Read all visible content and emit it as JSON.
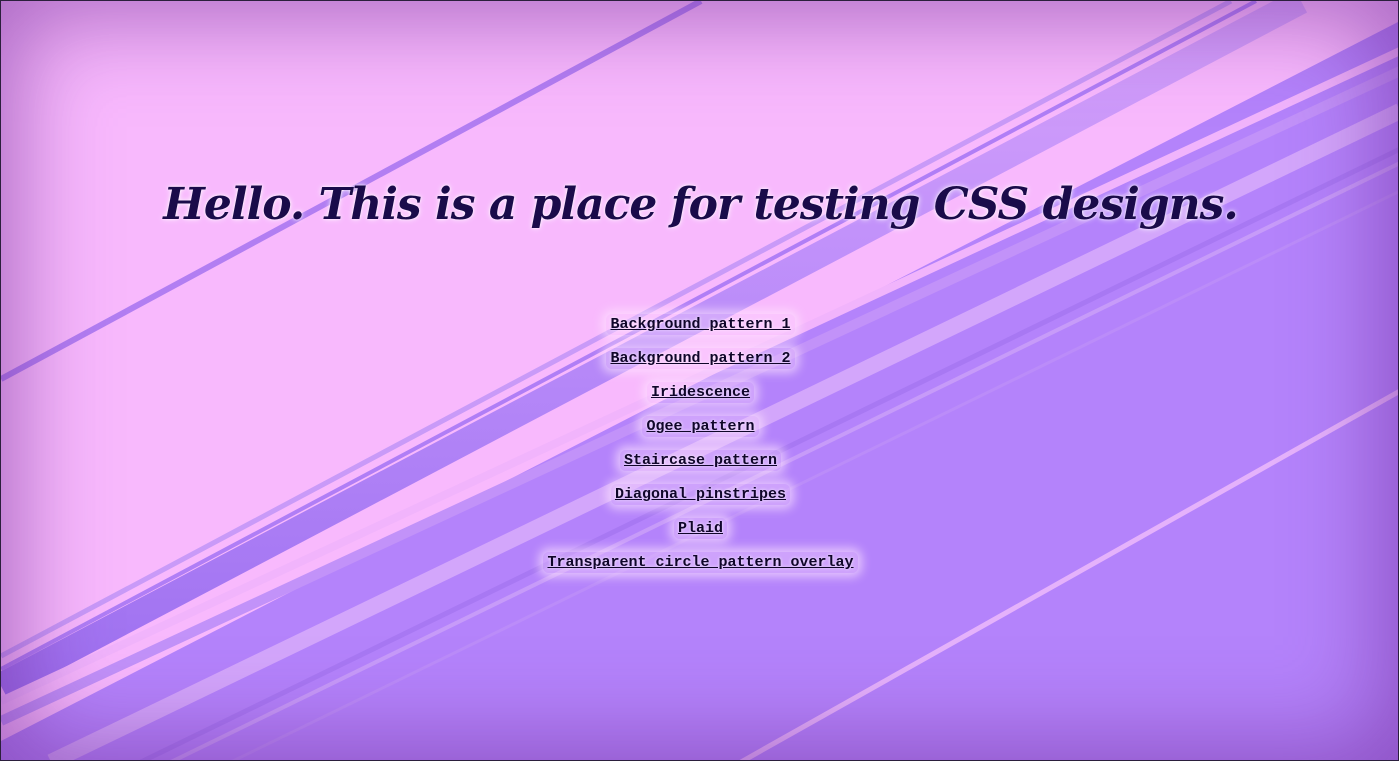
{
  "page": {
    "title": "Hello. This is a place for testing CSS designs."
  },
  "links": [
    {
      "label": "Background pattern 1"
    },
    {
      "label": "Background pattern 2"
    },
    {
      "label": "Iridescence"
    },
    {
      "label": "Ogee pattern"
    },
    {
      "label": "Staircase pattern"
    },
    {
      "label": "Diagonal pinstripes"
    },
    {
      "label": "Plaid"
    },
    {
      "label": "Transparent circle pattern overlay"
    }
  ],
  "colors": {
    "background_light": "#f8b9fd",
    "background_purple": "#b685fb",
    "stripe": "#a778f5",
    "title_text": "#1a0b4a",
    "link_text": "#10062a"
  }
}
